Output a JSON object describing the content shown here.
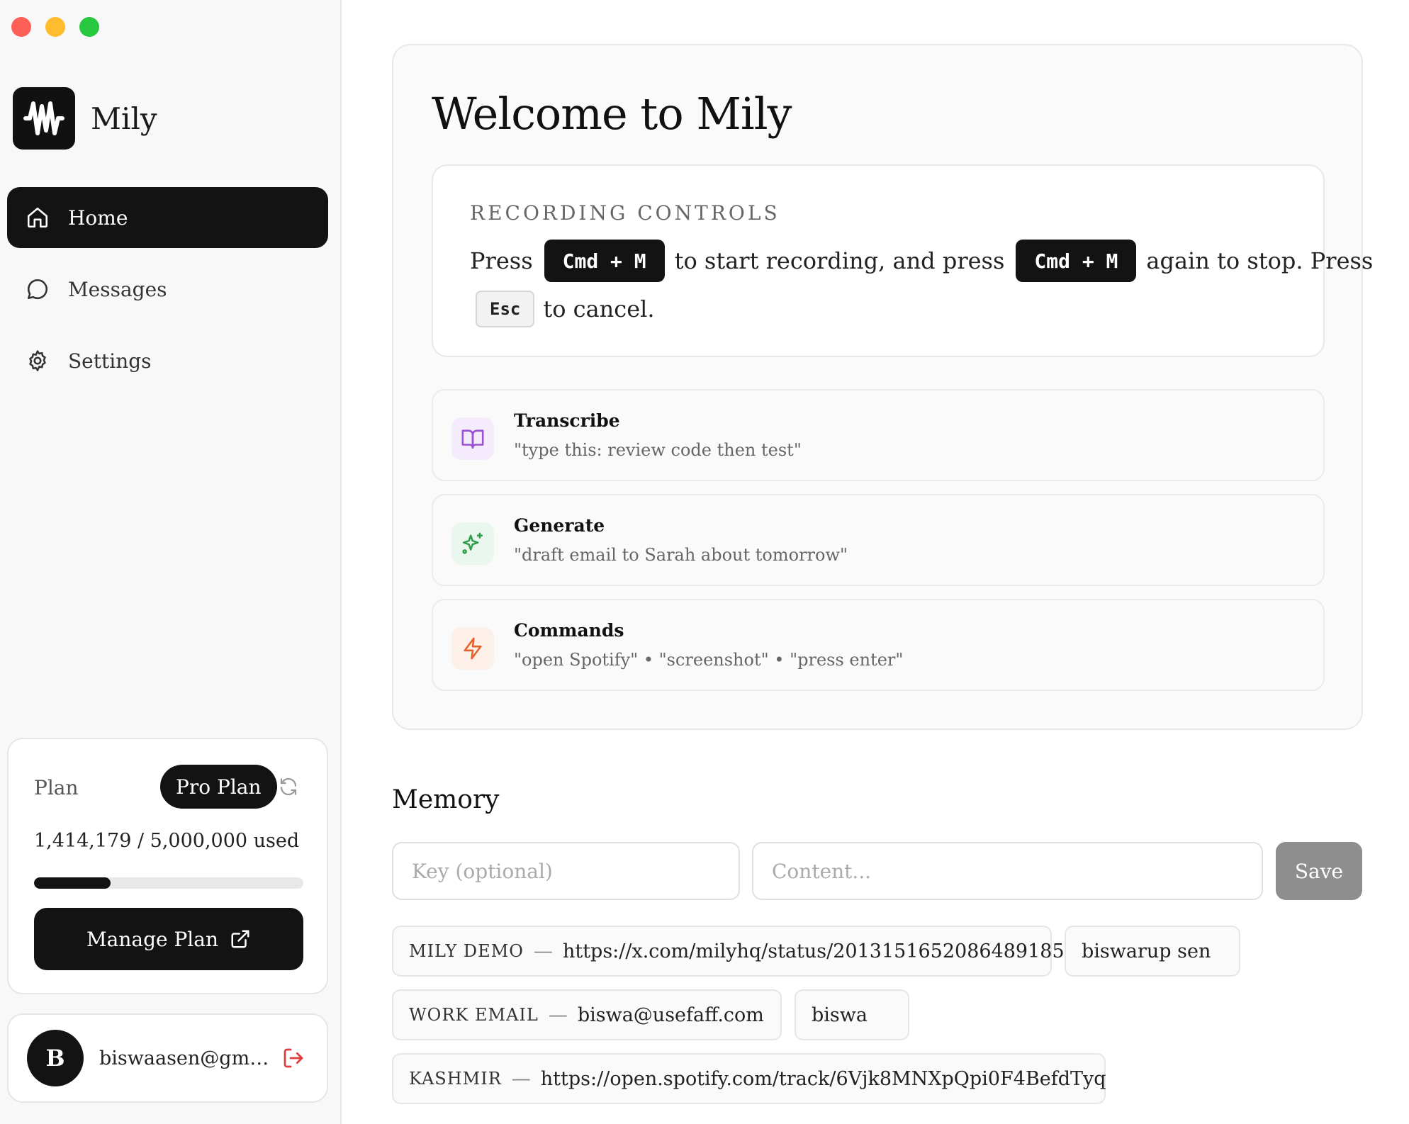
{
  "app": {
    "name": "Mily"
  },
  "nav": [
    {
      "label": "Home",
      "icon": "home-icon",
      "active": true
    },
    {
      "label": "Messages",
      "icon": "chat-icon",
      "active": false
    },
    {
      "label": "Settings",
      "icon": "gear-icon",
      "active": false
    }
  ],
  "plan": {
    "label": "Plan",
    "badge": "Pro Plan",
    "usage": "1,414,179 / 5,000,000 used",
    "used_fraction": 0.283,
    "manage_label": "Manage Plan"
  },
  "user": {
    "initial": "B",
    "email": "biswaasen@gmai..."
  },
  "welcome": {
    "title": "Welcome to Mily",
    "recording": {
      "heading": "RECORDING CONTROLS",
      "press": "Press",
      "shortcut": "Cmd + M",
      "mid": "to start recording, and press",
      "after": "again to stop. Press",
      "cancel_key": "Esc",
      "end": "to cancel."
    },
    "features": [
      {
        "title": "Transcribe",
        "desc": "\"type this: review code then test\"",
        "icon": "book-icon",
        "color": "#9b4fd8",
        "bg": "#f4ecfc"
      },
      {
        "title": "Generate",
        "desc": "\"draft email to Sarah about tomorrow\"",
        "icon": "sparkle-icon",
        "color": "#2e9e4a",
        "bg": "#eaf7ee"
      },
      {
        "title": "Commands",
        "desc": "\"open Spotify\" • \"screenshot\" • \"press enter\"",
        "icon": "lightning-icon",
        "color": "#e8612c",
        "bg": "#fdf0e8"
      }
    ]
  },
  "memory": {
    "title": "Memory",
    "key_placeholder": "Key (optional)",
    "content_placeholder": "Content...",
    "save_label": "Save",
    "items": [
      {
        "key": "MILY DEMO",
        "content": "https://x.com/milyhq/status/2013151652086489185"
      },
      {
        "key": "",
        "content": "biswarup sen"
      },
      {
        "key": "WORK EMAIL",
        "content": "biswa@usefaff.com"
      },
      {
        "key": "",
        "content": "biswa"
      },
      {
        "key": "KASHMIR",
        "content": "https://open.spotify.com/track/6Vjk8MNXpQpi0F4BefdTyq"
      }
    ]
  }
}
